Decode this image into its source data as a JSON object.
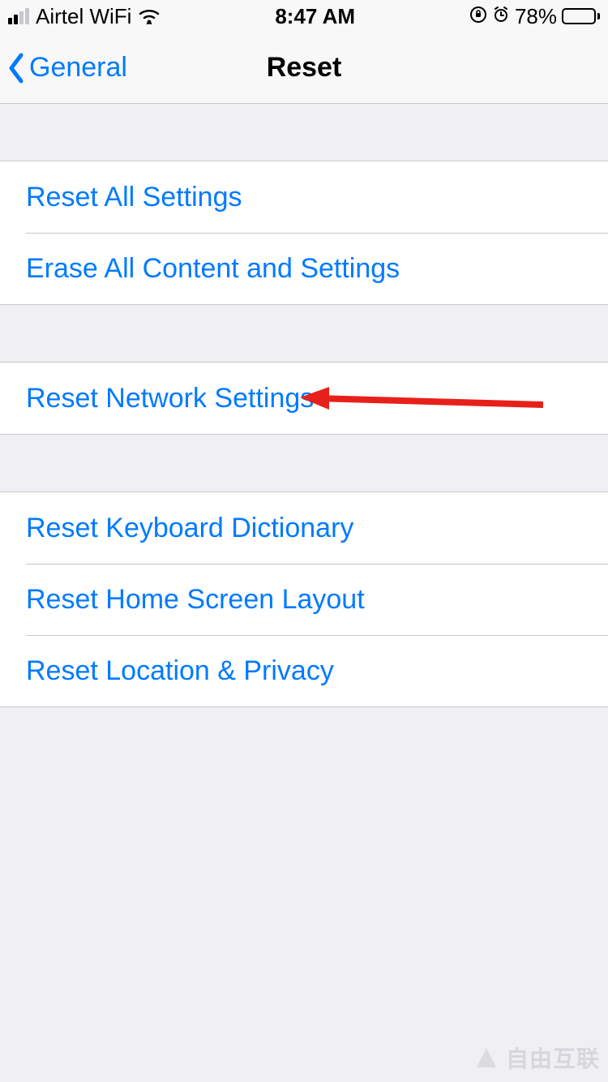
{
  "status": {
    "carrier": "Airtel WiFi",
    "time": "8:47 AM",
    "battery_percent": "78%"
  },
  "nav": {
    "back_label": "General",
    "title": "Reset"
  },
  "groups": [
    {
      "rows": [
        {
          "label": "Reset All Settings"
        },
        {
          "label": "Erase All Content and Settings"
        }
      ]
    },
    {
      "rows": [
        {
          "label": "Reset Network Settings"
        }
      ]
    },
    {
      "rows": [
        {
          "label": "Reset Keyboard Dictionary"
        },
        {
          "label": "Reset Home Screen Layout"
        },
        {
          "label": "Reset Location & Privacy"
        }
      ]
    }
  ],
  "watermark": "自由互联"
}
